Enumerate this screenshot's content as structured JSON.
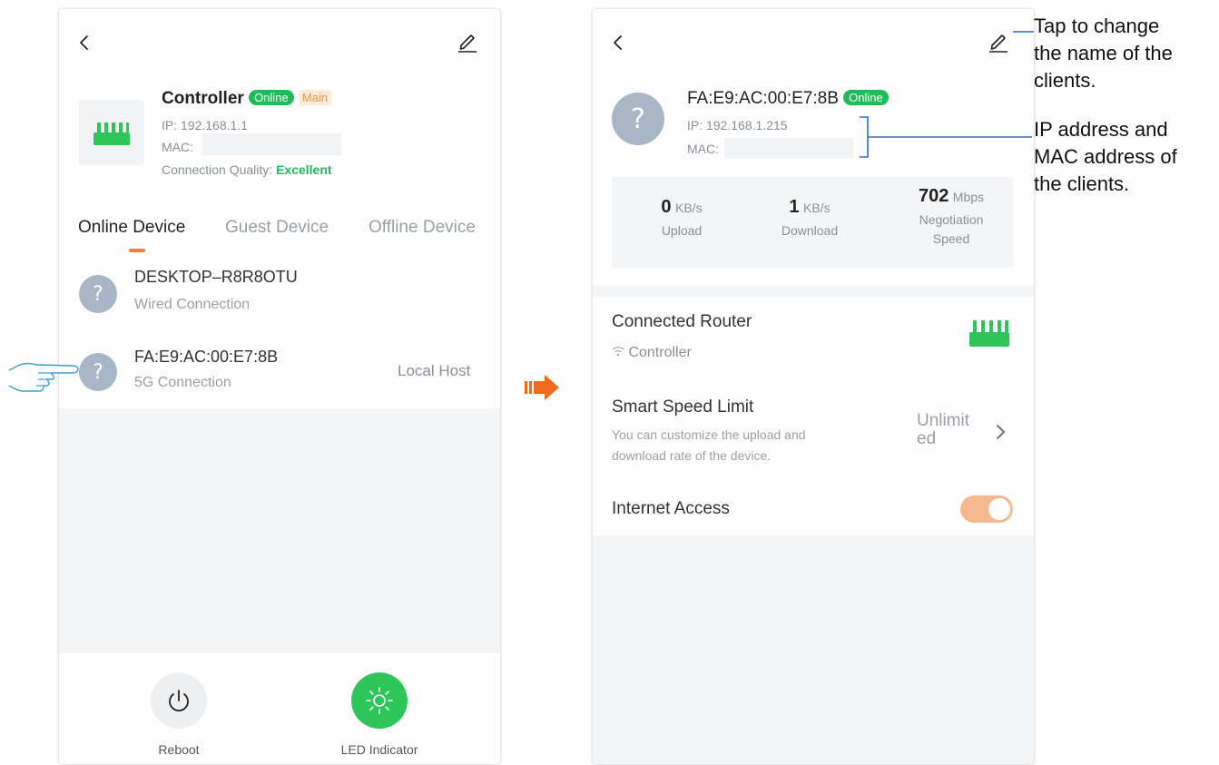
{
  "left_screen": {
    "controller": {
      "name": "Controller",
      "status_badge": "Online",
      "role_badge": "Main",
      "ip_label": "IP:",
      "ip_value": "192.168.1.1",
      "mac_label": "MAC:",
      "quality_label": "Connection Quality:",
      "quality_value": "Excellent"
    },
    "tabs": [
      "Online Device",
      "Guest Device",
      "Offline Device"
    ],
    "devices": [
      {
        "name": "DESKTOP–R8R8OTU",
        "connection": "Wired Connection",
        "tag": ""
      },
      {
        "name": "FA:E9:AC:00:E7:8B",
        "connection": "5G Connection",
        "tag": "Local Host"
      }
    ],
    "actions": {
      "reboot_label": "Reboot",
      "led_label": "LED Indicator"
    }
  },
  "right_screen": {
    "device": {
      "name": "FA:E9:AC:00:E7:8B",
      "status_badge": "Online",
      "ip_label": "IP:",
      "ip_value": "192.168.1.215",
      "mac_label": "MAC:"
    },
    "stats": {
      "upload_value": "0",
      "upload_unit": "KB/s",
      "upload_label": "Upload",
      "download_value": "1",
      "download_unit": "KB/s",
      "download_label": "Download",
      "speed_value": "702",
      "speed_unit": "Mbps",
      "speed_label_1": "Negotiation",
      "speed_label_2": "Speed"
    },
    "connected_router": {
      "title": "Connected Router",
      "value": "Controller"
    },
    "speed_limit": {
      "title": "Smart Speed Limit",
      "desc_1": "You can customize the upload and",
      "desc_2": "download rate of the device.",
      "value_1": "Unlimit",
      "value_2": "ed"
    },
    "internet_access": {
      "title": "Internet Access",
      "enabled": true
    }
  },
  "annotations": {
    "rename_1": "Tap to change",
    "rename_2": "the name of the",
    "rename_3": "clients.",
    "address_1": "IP address and",
    "address_2": "MAC address of",
    "address_3": "the clients."
  },
  "colors": {
    "accent_orange": "#f0803c",
    "online_green": "#1fbd5a",
    "router_green": "#2ec55a",
    "toggle_on": "#f6b98f",
    "callout_blue": "#2f6fd0",
    "arrow_orange": "#f26b1d"
  }
}
